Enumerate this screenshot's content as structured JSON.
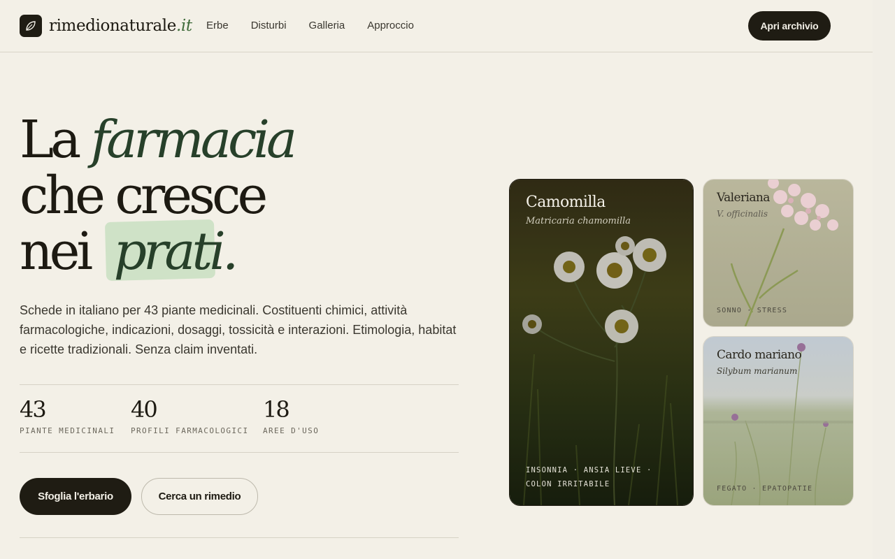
{
  "brand": {
    "name": "rimedionaturale",
    "tld": ".it",
    "logo_icon": "leaf-icon"
  },
  "nav": {
    "items": [
      "Erbe",
      "Disturbi",
      "Galleria",
      "Approccio"
    ]
  },
  "header": {
    "cta_label": "Apri archivio"
  },
  "hero": {
    "line1_plain": "La ",
    "line1_italic": "farmacia",
    "line2": "che cresce",
    "line3_plain": "nei ",
    "line3_italic": "prati."
  },
  "intro": "Schede in italiano per 43 piante medicinali. Costituenti chimici, attività farmacologiche, indicazioni, dosaggi, tossicità e interazioni. Etimologia, habitat e ricette tradizionali. Senza claim inventati.",
  "stats": [
    {
      "value": "43",
      "label": "PIANTE MEDICINALI"
    },
    {
      "value": "40",
      "label": "PROFILI FARMACOLOGICI"
    },
    {
      "value": "18",
      "label": "AREE D'USO"
    }
  ],
  "actions": {
    "primary": "Sfoglia l'erbario",
    "secondary": "Cerca un rimedio"
  },
  "cards": [
    {
      "title": "Camomilla",
      "latin": "Matricaria chamomilla",
      "tags": "INSONNIA · ANSIA LIEVE · COLON IRRITABILE"
    },
    {
      "title": "Valeriana",
      "latin": "V. officinalis",
      "tags": "SONNO · STRESS"
    },
    {
      "title": "Cardo mariano",
      "latin": "Silybum marianum",
      "tags": "FEGATO · EPATOPATIE"
    }
  ],
  "colors": {
    "ink": "#1f1c13",
    "paper": "#f3f0e7",
    "accent_green": "#27402a",
    "highlight": "#cfe2c7"
  }
}
